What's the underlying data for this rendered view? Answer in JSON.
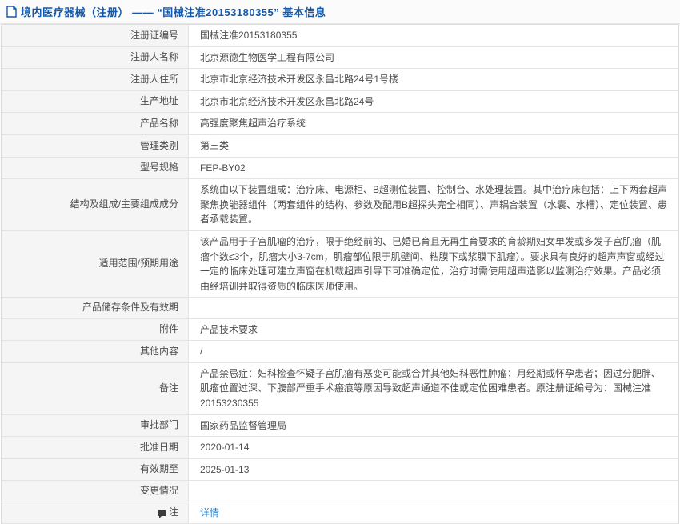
{
  "header": {
    "title": "境内医疗器械（注册） —— “国械注准20153180355” 基本信息",
    "icon": "document-icon"
  },
  "colors": {
    "title_blue": "#1558a8",
    "link_blue": "#1a78c2",
    "label_bg": "#f5f5f5",
    "border": "#e4e4e4"
  },
  "rows": [
    {
      "label": "注册证编号",
      "value": "国械注准20153180355"
    },
    {
      "label": "注册人名称",
      "value": "北京源德生物医学工程有限公司"
    },
    {
      "label": "注册人住所",
      "value": "北京市北京经济技术开发区永昌北路24号1号楼"
    },
    {
      "label": "生产地址",
      "value": "北京市北京经济技术开发区永昌北路24号"
    },
    {
      "label": "产品名称",
      "value": "高强度聚焦超声治疗系统"
    },
    {
      "label": "管理类别",
      "value": "第三类"
    },
    {
      "label": "型号规格",
      "value": "FEP-BY02"
    },
    {
      "label": "结构及组成/主要组成成分",
      "value": "系统由以下装置组成：治疗床、电源柜、B超测位装置、控制台、水处理装置。其中治疗床包括：上下两套超声聚焦换能器组件（两套组件的结构、参数及配用B超探头完全相同）、声耦合装置（水囊、水槽）、定位装置、患者承载装置。"
    },
    {
      "label": "适用范围/预期用途",
      "value": "该产品用于子宫肌瘤的治疗，限于绝经前的、已婚已育且无再生育要求的育龄期妇女单发或多发子宫肌瘤（肌瘤个数≤3个，肌瘤大小3-7cm，肌瘤部位限于肌壁间、粘膜下或浆膜下肌瘤）。要求具有良好的超声声窗或经过一定的临床处理可建立声窗在机载超声引导下可准确定位，治疗时需使用超声造影以监测治疗效果。产品必须由经培训并取得资质的临床医师使用。"
    },
    {
      "label": "产品储存条件及有效期",
      "value": ""
    },
    {
      "label": "附件",
      "value": "产品技术要求"
    },
    {
      "label": "其他内容",
      "value": "/"
    },
    {
      "label": "备注",
      "value": "产品禁忌症：妇科检查怀疑子宫肌瘤有恶变可能或合并其他妇科恶性肿瘤；月经期或怀孕患者；因过分肥胖、肌瘤位置过深、下腹部严重手术瘢痕等原因导致超声通道不佳或定位困难患者。原注册证编号为：国械注准20153230355"
    },
    {
      "label": "审批部门",
      "value": "国家药品监督管理局"
    },
    {
      "label": "批准日期",
      "value": "2020-01-14"
    },
    {
      "label": "有效期至",
      "value": "2025-01-13"
    },
    {
      "label": "变更情况",
      "value": ""
    },
    {
      "label": "注",
      "value": "详情",
      "icon": "note-icon",
      "value_is_link": true
    }
  ]
}
